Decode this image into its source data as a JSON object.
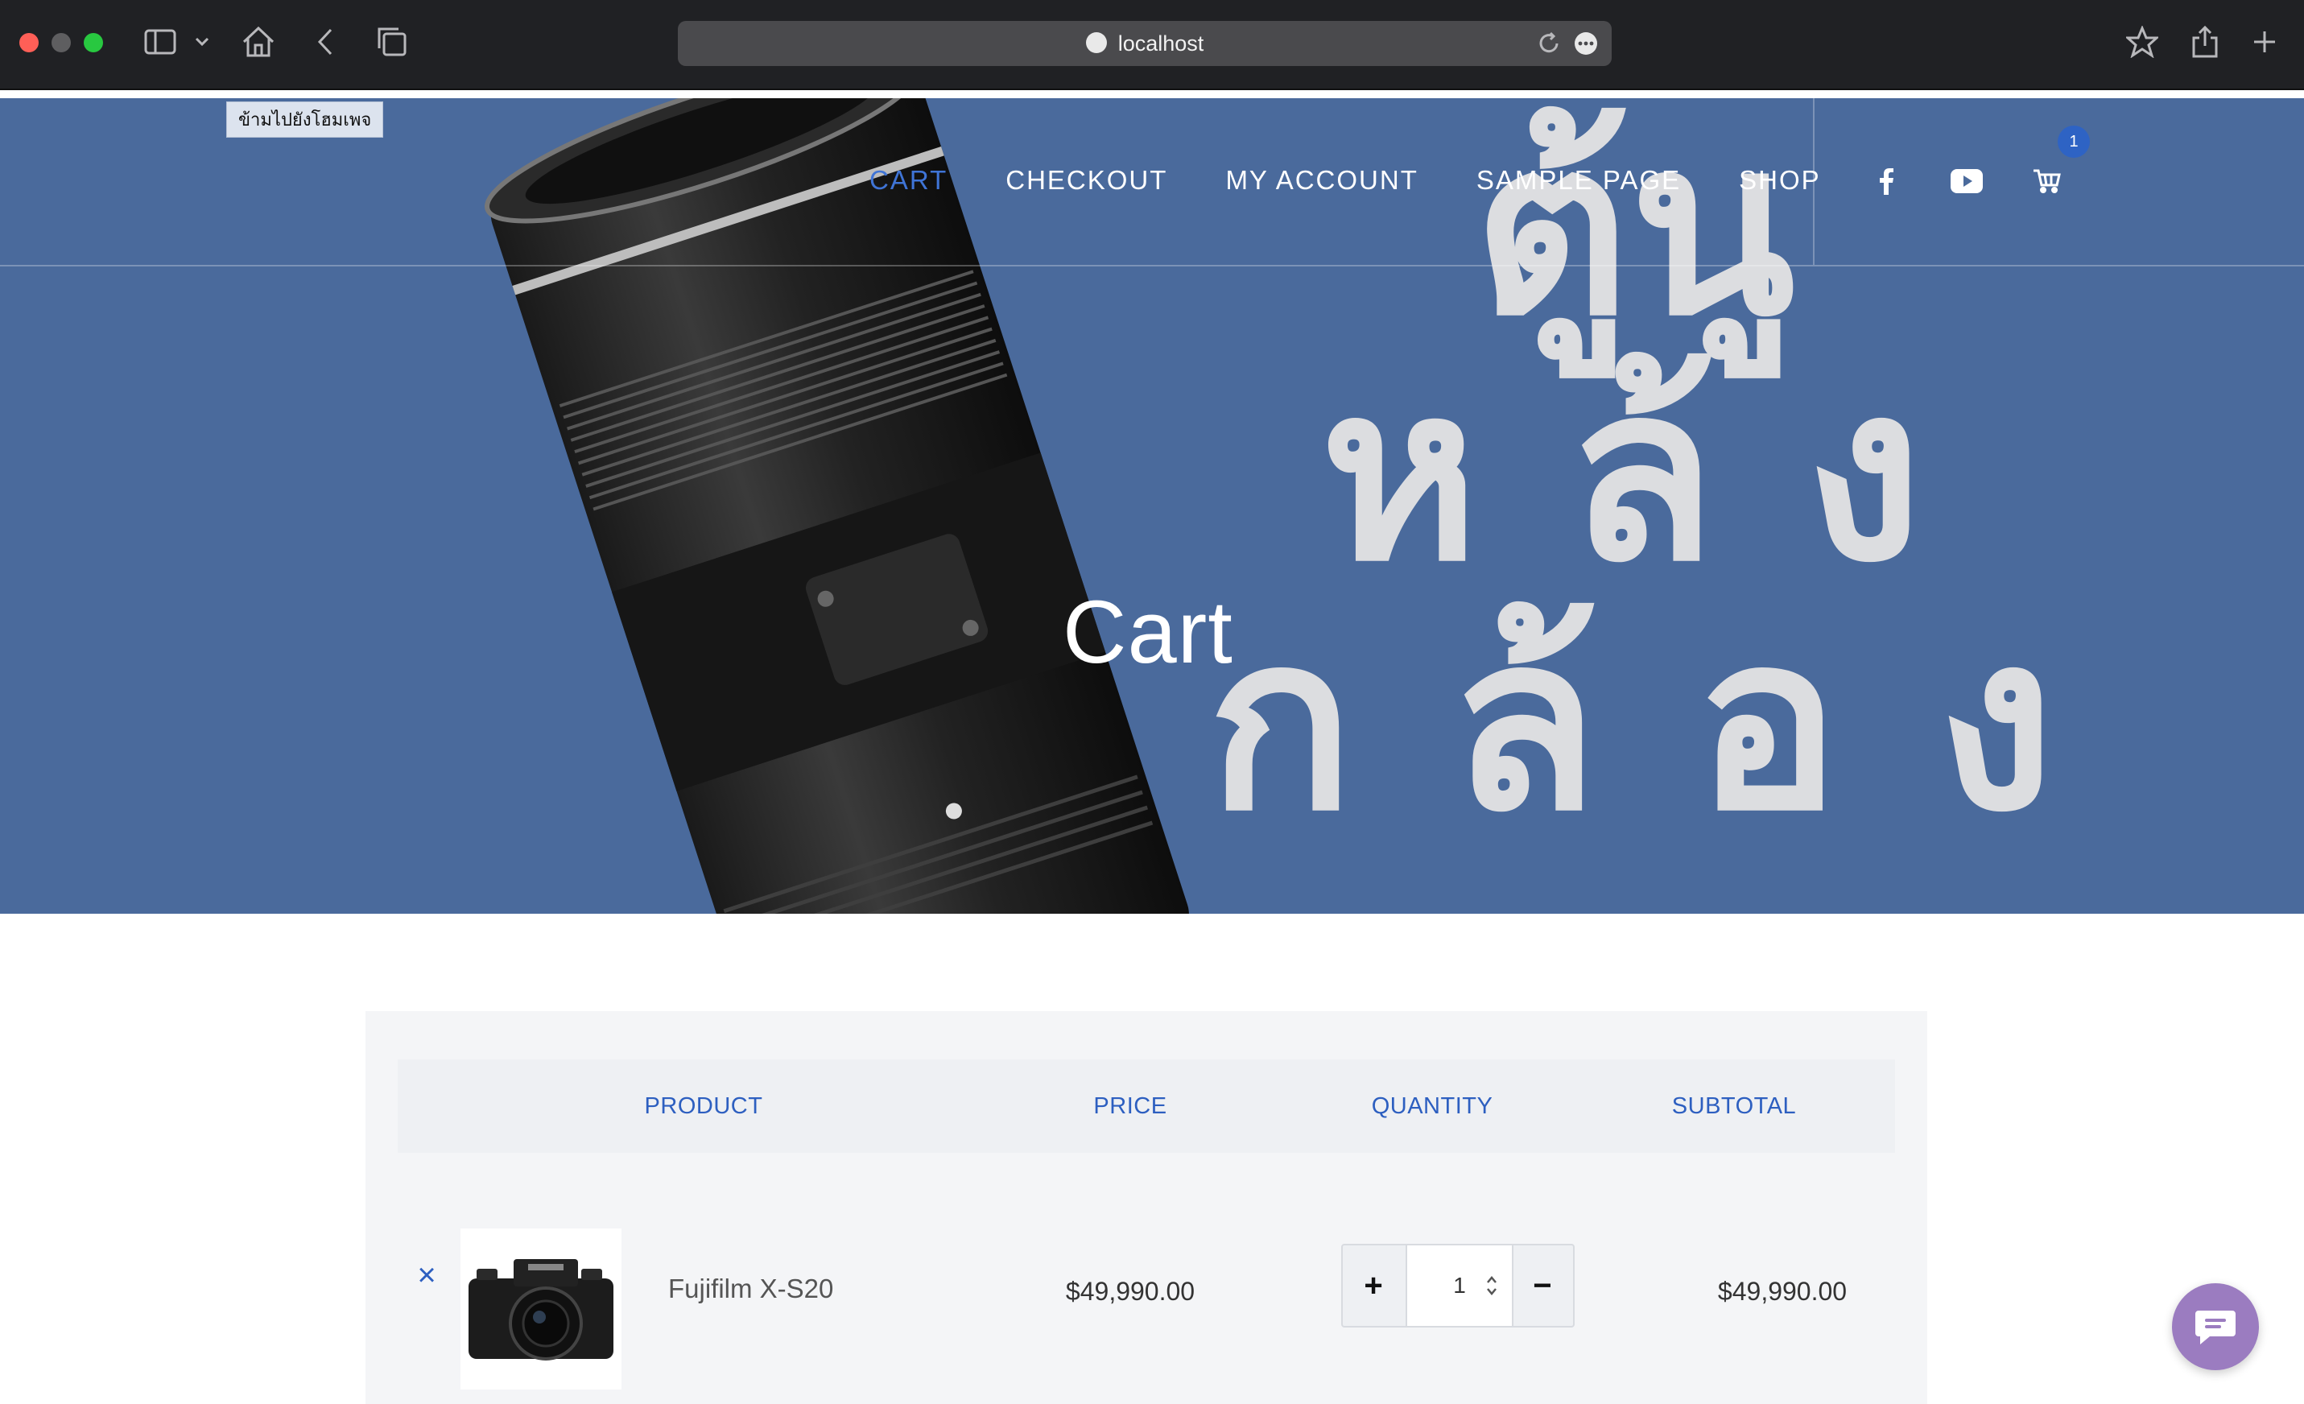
{
  "browser": {
    "url": "localhost",
    "icons": [
      "sidebar-icon",
      "chevron-down-icon",
      "home-icon",
      "back-icon",
      "tabs-icon",
      "reload-icon",
      "more-icon",
      "bookmark-star-icon",
      "share-icon",
      "new-tab-icon"
    ]
  },
  "site": {
    "skip_link": "ข้ามไปยังโฮมเพจ",
    "nav": [
      {
        "label": "CART",
        "active": true
      },
      {
        "label": "CHECKOUT",
        "active": false
      },
      {
        "label": "MY ACCOUNT",
        "active": false
      },
      {
        "label": "SAMPLE PAGE",
        "active": false
      },
      {
        "label": "SHOP",
        "active": false
      }
    ],
    "social": [
      "facebook-icon",
      "youtube-icon"
    ],
    "cart_count": "1",
    "accent_color": "#3f74d6",
    "hero_bg": "#4a6a9c"
  },
  "hero": {
    "title": "Cart",
    "background_text_rows": [
      "ตู้นู",
      "หล้ง",
      "กล้อง"
    ]
  },
  "cart": {
    "headers": {
      "product": "PRODUCT",
      "price": "PRICE",
      "quantity": "QUANTITY",
      "subtotal": "SUBTOTAL"
    },
    "items": [
      {
        "name": "Fujifilm X-S20",
        "price": "$49,990.00",
        "quantity": "1",
        "subtotal": "$49,990.00",
        "remove": "×",
        "plus": "+",
        "minus": "−"
      }
    ]
  }
}
